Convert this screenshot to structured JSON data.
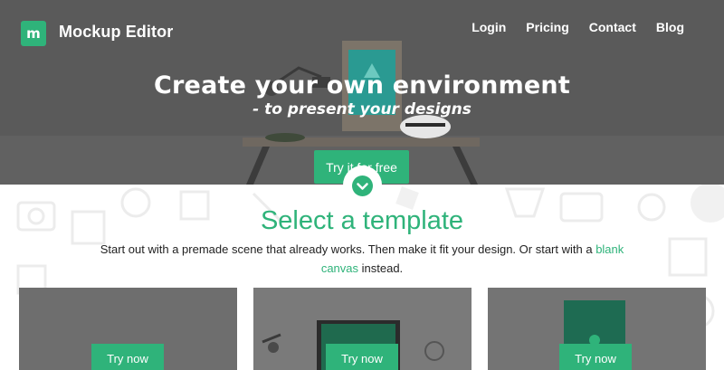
{
  "header": {
    "logo_letter": "m",
    "brand": "Mockup Editor",
    "nav": [
      "Login",
      "Pricing",
      "Contact",
      "Blog"
    ]
  },
  "hero": {
    "title": "Create your own environment",
    "subtitle": "- to present your designs",
    "cta_label": "Try it for free"
  },
  "section": {
    "title": "Select a template",
    "text_before": "Start out with a premade scene that already works. Then make it fit your design. Or start with a ",
    "link_text": "blank canvas",
    "text_after": " instead."
  },
  "cards": [
    {
      "button": "Try now"
    },
    {
      "button": "Try now"
    },
    {
      "button": "Try now"
    }
  ],
  "colors": {
    "accent": "#2fb37a",
    "hero_overlay": "#5b5b5b"
  },
  "icons": [
    "logo-icon",
    "chevron-down-icon"
  ]
}
